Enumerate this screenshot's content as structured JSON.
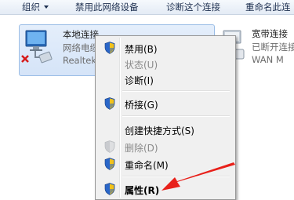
{
  "toolbar": {
    "organize": "组织",
    "disable_device": "禁用此网络设备",
    "diagnose": "诊断这个连接",
    "rename": "重命名此连"
  },
  "connections": [
    {
      "name": "本地连接",
      "type": "网络电缆",
      "device": "Realtek"
    },
    {
      "name": "宽带连接",
      "status": "已断开连接",
      "device": "WAN M"
    }
  ],
  "context_menu": {
    "items": [
      {
        "label": "禁用(B)",
        "enabled": true,
        "shield": true
      },
      {
        "label": "状态(U)",
        "enabled": false,
        "shield": false
      },
      {
        "label": "诊断(I)",
        "enabled": true,
        "shield": false
      },
      {
        "label": "桥接(G)",
        "enabled": true,
        "shield": true
      },
      {
        "label": "创建快捷方式(S)",
        "enabled": true,
        "shield": false
      },
      {
        "label": "删除(D)",
        "enabled": false,
        "shield": true
      },
      {
        "label": "重命名(M)",
        "enabled": true,
        "shield": true
      },
      {
        "label": "属性(R)",
        "enabled": true,
        "shield": true,
        "bold": true
      }
    ]
  },
  "colors": {
    "annotation_arrow": "#e8201a",
    "selection": "#d5e4f8",
    "menu_bg": "#f0f0f0"
  }
}
